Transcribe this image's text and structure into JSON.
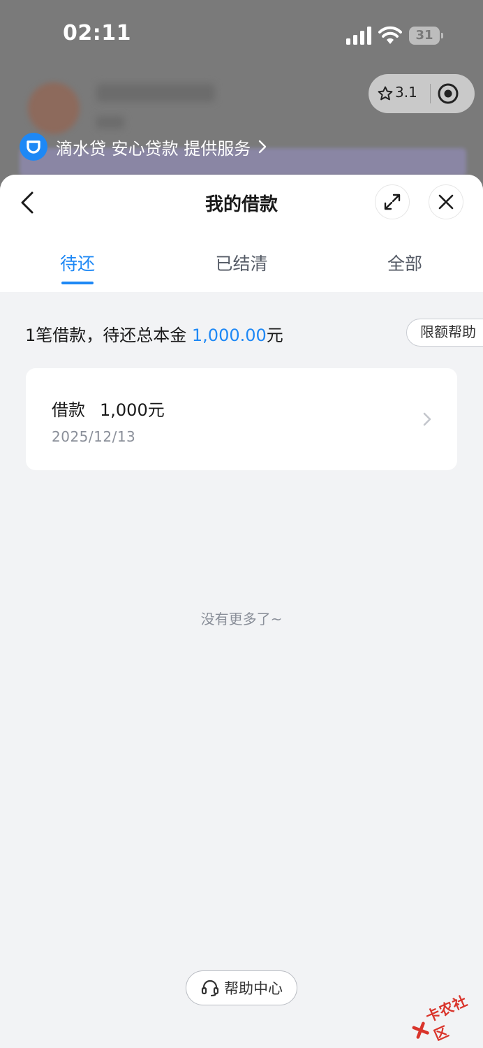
{
  "status_bar": {
    "time": "02:11",
    "battery": "31"
  },
  "capsule": {
    "rating": "3.1"
  },
  "provider": {
    "text": "滴水贷 安心贷款 提供服务"
  },
  "sheet": {
    "title": "我的借款",
    "tabs": [
      {
        "label": "待还",
        "active": true
      },
      {
        "label": "已结清",
        "active": false
      },
      {
        "label": "全部",
        "active": false
      }
    ],
    "summary": {
      "prefix": "1笔借款，待还总本金 ",
      "amount": "1,000.00",
      "suffix": "元"
    },
    "help_pill": "限额帮助",
    "loans": [
      {
        "title": "借款",
        "amount": "1,000元",
        "date": "2025/12/13"
      }
    ],
    "no_more": "没有更多了~",
    "help_center": "帮助中心"
  },
  "watermark": {
    "text": "卡农社区"
  },
  "colors": {
    "accent": "#1e88f5",
    "sheet_bg": "#f2f3f5",
    "overlay": "#7a7a7a"
  }
}
